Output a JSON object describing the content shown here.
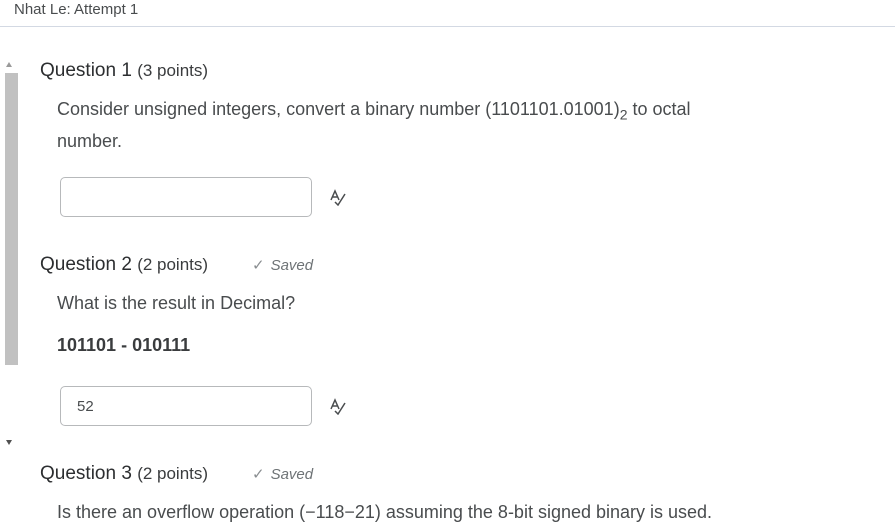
{
  "header": {
    "title": "Nhat Le: Attempt 1"
  },
  "questions": [
    {
      "title": "Question 1",
      "points": "(3 points)",
      "text_before_sub": "Consider unsigned integers, convert a binary number (1101101.01001)",
      "subscript": "2",
      "text_after_sub": " to octal",
      "text_line2": "number.",
      "answer_value": "",
      "saved": ""
    },
    {
      "title": "Question 2",
      "points": "(2 points)",
      "saved": "Saved",
      "text": "What is the result in Decimal?",
      "expression": "101101 - 010111",
      "answer_value": "52"
    },
    {
      "title": "Question 3",
      "points": "(2 points)",
      "saved": "Saved",
      "text": "Is there an overflow operation (−118−21) assuming the 8-bit signed binary is used."
    }
  ],
  "icons": {
    "spellcheck": "spellcheck-icon",
    "check": "checkmark-icon"
  }
}
